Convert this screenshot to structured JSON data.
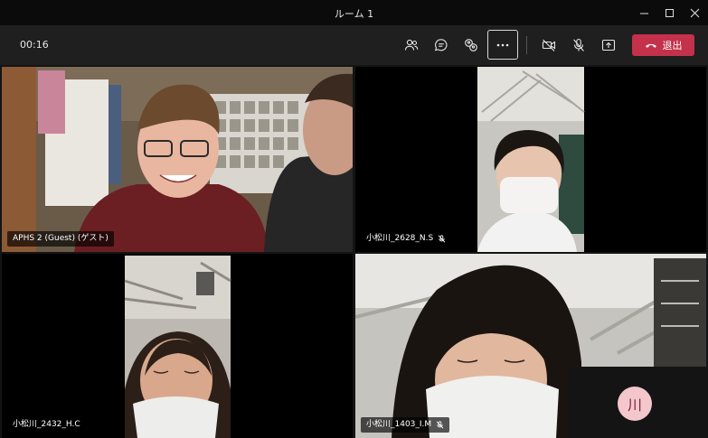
{
  "window": {
    "title": "ルーム 1"
  },
  "toolbar": {
    "timer": "00:16",
    "leave_label": "退出"
  },
  "icons": {
    "participants": "participants-icon",
    "chat": "chat-icon",
    "rooms": "breakout-rooms-icon",
    "more": "more-icon",
    "camera": "camera-off-icon",
    "mic": "mic-off-icon",
    "share": "share-icon",
    "hangup": "hangup-icon"
  },
  "colors": {
    "leave": "#c4314b",
    "selected_outline": "#7f85f5",
    "avatar_bg": "#f4c7cc"
  },
  "tiles": [
    {
      "name": "APHS 2 (Guest) (ゲスト)",
      "muted": false
    },
    {
      "name": "小松川_2628_N.S",
      "muted": true
    },
    {
      "name": "小松川_2432_H.C",
      "muted": false
    },
    {
      "name": "小松川_1403_I.M",
      "muted": true
    }
  ],
  "avatar": {
    "initials": "川"
  }
}
